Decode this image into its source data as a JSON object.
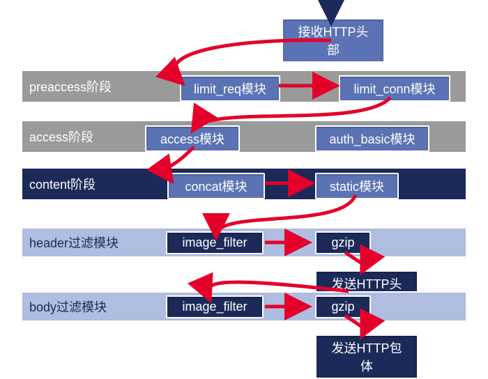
{
  "top_node": "接收HTTP头部",
  "stages": {
    "preaccess": {
      "label": "preaccess阶段",
      "nodes": [
        "limit_req模块",
        "limit_conn模块"
      ]
    },
    "access": {
      "label": "access阶段",
      "nodes": [
        "access模块",
        "auth_basic模块"
      ]
    },
    "content": {
      "label": "content阶段",
      "nodes": [
        "concat模块",
        "static模块"
      ]
    },
    "header": {
      "label": "header过滤模块",
      "nodes": [
        "image_filter",
        "gzip"
      ]
    },
    "body": {
      "label": "body过滤模块",
      "nodes": [
        "image_filter",
        "gzip"
      ]
    }
  },
  "send_header": "发送HTTP头部",
  "send_body": "发送HTTP包体",
  "flow": [
    "top_node → preaccess.limit_req模块",
    "preaccess.limit_req模块 → preaccess.limit_conn模块",
    "preaccess.limit_conn模块 → access.access模块",
    "access.access模块 → content.concat模块",
    "content.concat模块 → content.static模块",
    "content.static模块 → header.image_filter",
    "header.image_filter → header.gzip",
    "header.gzip → 发送HTTP头部",
    "发送HTTP头部 → body.image_filter",
    "body.image_filter → body.gzip",
    "body.gzip → 发送HTTP包体"
  ]
}
